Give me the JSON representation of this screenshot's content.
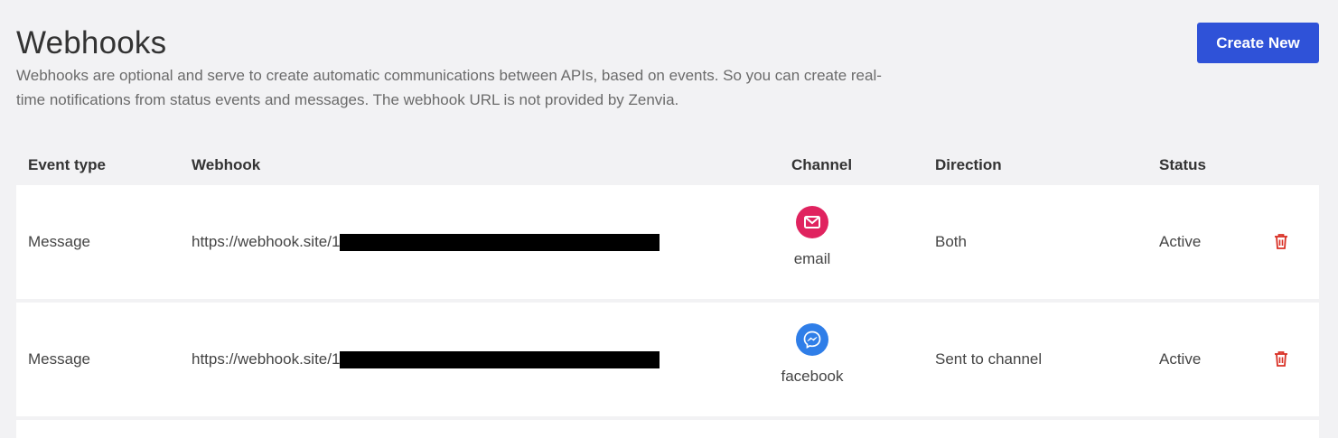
{
  "page": {
    "title": "Webhooks",
    "description": "Webhooks are optional and serve to create automatic communications between APIs, based on events. So you can create real-time notifications from status events and messages. The webhook URL is not provided by Zenvia.",
    "create_button_label": "Create New"
  },
  "colors": {
    "accent": "#2f52d8",
    "email_channel": "#e0235f",
    "facebook_channel": "#2f7ee8",
    "delete_icon": "#d93025"
  },
  "table": {
    "headers": {
      "event_type": "Event type",
      "webhook": "Webhook",
      "channel": "Channel",
      "direction": "Direction",
      "status": "Status"
    },
    "rows": [
      {
        "event_type": "Message",
        "webhook": "https://webhook.site/1",
        "channel": "email",
        "channel_icon": "email-icon",
        "direction": "Both",
        "status": "Active",
        "action_icon": "trash-icon"
      },
      {
        "event_type": "Message",
        "webhook": "https://webhook.site/1",
        "channel": "facebook",
        "channel_icon": "messenger-icon",
        "direction": "Sent to channel",
        "status": "Active",
        "action_icon": "trash-icon"
      }
    ]
  }
}
